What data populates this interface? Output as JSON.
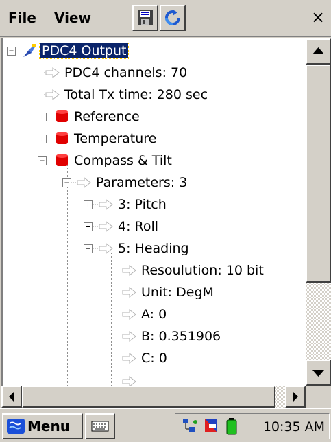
{
  "menu": {
    "file_label": "File",
    "view_label": "View"
  },
  "toolbar": {
    "save_icon": "floppy-disk-icon",
    "refresh_icon": "refresh-icon",
    "close_label": "×"
  },
  "tree": {
    "root_label": "PDC4 Output",
    "channels_label": "PDC4 channels: 70",
    "tx_time_label": "Total Tx time: 280 sec",
    "reference_label": "Reference",
    "temperature_label": "Temperature",
    "compass_label": "Compass & Tilt",
    "parameters_label": "Parameters: 3",
    "pitch_label": "3: Pitch",
    "roll_label": "4: Roll",
    "heading_label": "5: Heading",
    "resolution_label": "Resoulution: 10 bit",
    "unit_label": "Unit: DegM",
    "a_label": "A: 0",
    "b_label": "B: 0.351906",
    "c_label": "C: 0"
  },
  "taskbar": {
    "start_label": "Menu",
    "clock": "10:35 AM"
  },
  "colors": {
    "selection": "#0a246a",
    "chrome": "#d4d0c8",
    "db_red": "#e00000",
    "arrow_gray": "#c0c0c0"
  }
}
